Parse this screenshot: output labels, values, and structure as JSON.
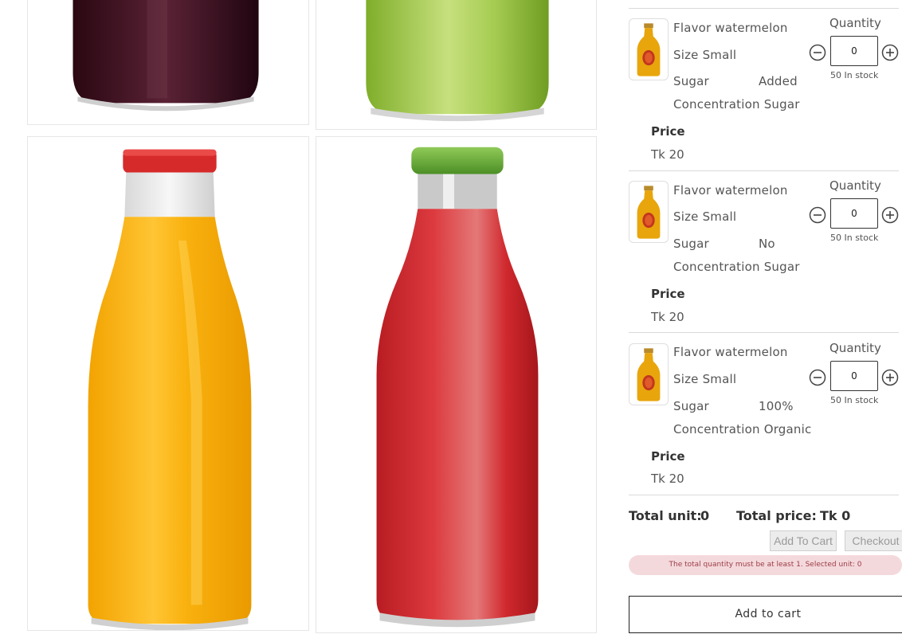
{
  "variants": [
    {
      "flavor_label": "Flavor",
      "flavor_value": "watermelon",
      "size_label": "Size",
      "size_value": "Small",
      "sugar_label_line1": "Sugar",
      "sugar_label_line2": "Concentration",
      "sugar_value_line1": "Added",
      "sugar_value_line2": "Sugar",
      "price_label": "Price",
      "price_value": "Tk 20",
      "quantity_label": "Quantity",
      "quantity_value": "0",
      "stock_text": "50 In stock"
    },
    {
      "flavor_label": "Flavor",
      "flavor_value": "watermelon",
      "size_label": "Size",
      "size_value": "Small",
      "sugar_label_line1": "Sugar",
      "sugar_label_line2": "Concentration",
      "sugar_value_line1": "No",
      "sugar_value_line2": "Sugar",
      "price_label": "Price",
      "price_value": "Tk 20",
      "quantity_label": "Quantity",
      "quantity_value": "0",
      "stock_text": "50 In stock"
    },
    {
      "flavor_label": "Flavor",
      "flavor_value": "watermelon",
      "size_label": "Size",
      "size_value": "Small",
      "sugar_label_line1": "Sugar",
      "sugar_label_line2": "Concentration",
      "sugar_value_line1": "100%",
      "sugar_value_line2": "Organic",
      "price_label": "Price",
      "price_value": "Tk 20",
      "quantity_label": "Quantity",
      "quantity_value": "0",
      "stock_text": "50 In stock"
    }
  ],
  "totals": {
    "units_label": "Total unit:",
    "units_value": "0",
    "price_label": "Total price:",
    "price_value": "Tk 0"
  },
  "actions": {
    "add_to_cart_small": "Add To Cart",
    "checkout": "Checkout",
    "add_to_cart": "Add to cart"
  },
  "alert": {
    "message": "The total quantity must be at least 1. Selected unit: 0"
  },
  "icons": {
    "minus": "minus-circle-icon",
    "plus": "plus-circle-icon"
  },
  "colors": {
    "alert_bg": "#f4d9dc",
    "alert_text": "#9b3c46",
    "disabled_button": "#ececec",
    "orange_juice": "#f6ae0a",
    "red_juice": "#cf2a2c",
    "green_juice": "#8cb83a",
    "dark_juice": "#3b1020"
  }
}
